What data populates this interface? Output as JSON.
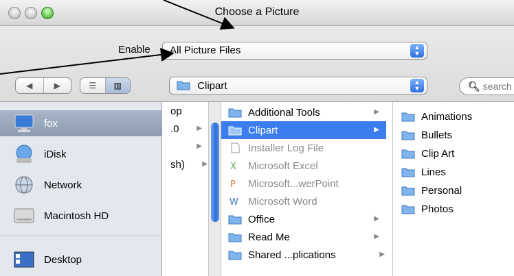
{
  "window": {
    "title": "Choose a Picture"
  },
  "toolbar": {
    "enable_label": "Enable",
    "enable_value": "All Picture Files",
    "location_value": "Clipart",
    "search_placeholder": "search"
  },
  "nav": {
    "back_icon": "back-arrow-icon",
    "forward_icon": "forward-arrow-icon",
    "list_view_icon": "list-view-icon",
    "column_view_icon": "column-view-icon"
  },
  "sidebar": {
    "items": [
      {
        "label": "fox",
        "icon": "computer-icon"
      },
      {
        "label": "iDisk",
        "icon": "idisk-icon"
      },
      {
        "label": "Network",
        "icon": "network-globe-icon"
      },
      {
        "label": "Macintosh HD",
        "icon": "hard-drive-icon"
      },
      {
        "label": "Desktop",
        "icon": "desktop-icon"
      }
    ]
  },
  "column_a": {
    "items": [
      "op",
      ".0",
      "",
      "sh)"
    ]
  },
  "column_b": {
    "items": [
      {
        "label": "Additional Tools",
        "type": "folder"
      },
      {
        "label": "Clipart",
        "type": "folder"
      },
      {
        "label": "Installer Log File",
        "type": "file"
      },
      {
        "label": "Microsoft Excel",
        "type": "app"
      },
      {
        "label": "Microsoft...werPoint",
        "type": "app"
      },
      {
        "label": "Microsoft Word",
        "type": "app"
      },
      {
        "label": "Office",
        "type": "folder"
      },
      {
        "label": "Read Me",
        "type": "folder"
      },
      {
        "label": "Shared ...plications",
        "type": "folder"
      }
    ]
  },
  "column_c": {
    "items": [
      "Animations",
      "Bullets",
      "Clip Art",
      "Lines",
      "Personal",
      "Photos"
    ]
  },
  "colors": {
    "selection": "#3b7ded",
    "sidebar_bg": "#e3e8ef",
    "sidebar_selected": "#8c9bb1",
    "folder_blue": "#7fb4ec"
  }
}
